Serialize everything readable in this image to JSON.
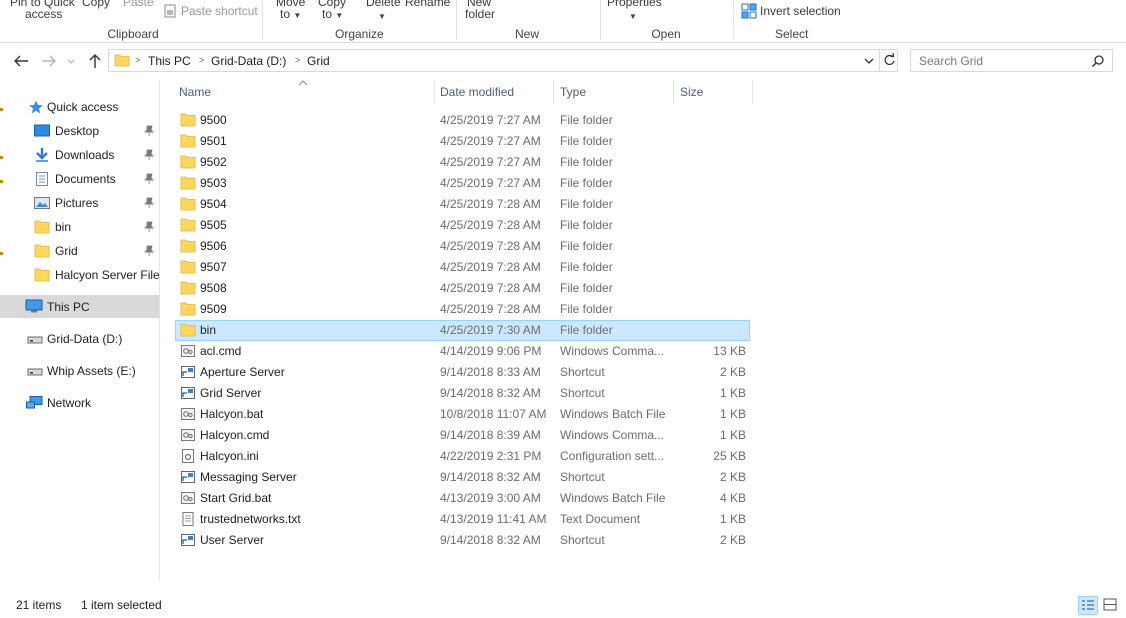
{
  "ribbon": {
    "pin_quick_access": "Pin to Quick",
    "pin_quick_access_2": "access",
    "copy": "Copy",
    "paste": "Paste",
    "paste_shortcut": "Paste shortcut",
    "move_to": "Move",
    "move_to_2": "to",
    "copy_to": "Copy",
    "copy_to_2": "to",
    "delete": "Delete",
    "rename": "Rename",
    "new_folder": "New",
    "new_folder_2": "folder",
    "properties": "Properties",
    "invert_selection": "Invert selection",
    "groups": {
      "clipboard": "Clipboard",
      "organize": "Organize",
      "new": "New",
      "open": "Open",
      "select": "Select"
    }
  },
  "address": {
    "crumbs": [
      "This PC",
      "Grid-Data (D:)",
      "Grid"
    ]
  },
  "search": {
    "placeholder": "Search Grid"
  },
  "sidebar": {
    "items": [
      {
        "label": "Quick access",
        "icon": "star-icon"
      },
      {
        "label": "Desktop",
        "icon": "desktop-icon"
      },
      {
        "label": "Downloads",
        "icon": "download-icon"
      },
      {
        "label": "Documents",
        "icon": "document-icon"
      },
      {
        "label": "Pictures",
        "icon": "pictures-icon"
      },
      {
        "label": "bin",
        "icon": "folder-icon"
      },
      {
        "label": "Grid",
        "icon": "folder-icon"
      },
      {
        "label": "Halcyon Server Files",
        "icon": "folder-icon"
      },
      {
        "label": "This PC",
        "icon": "computer-icon"
      },
      {
        "label": "Grid-Data (D:)",
        "icon": "drive-icon"
      },
      {
        "label": "Whip Assets (E:)",
        "icon": "drive-icon"
      },
      {
        "label": "Network",
        "icon": "network-icon"
      }
    ]
  },
  "columns": {
    "name": "Name",
    "date": "Date modified",
    "type": "Type",
    "size": "Size"
  },
  "files": [
    {
      "name": "9500",
      "date": "4/25/2019 7:27 AM",
      "type": "File folder",
      "size": "",
      "icon": "folder"
    },
    {
      "name": "9501",
      "date": "4/25/2019 7:27 AM",
      "type": "File folder",
      "size": "",
      "icon": "folder"
    },
    {
      "name": "9502",
      "date": "4/25/2019 7:27 AM",
      "type": "File folder",
      "size": "",
      "icon": "folder"
    },
    {
      "name": "9503",
      "date": "4/25/2019 7:27 AM",
      "type": "File folder",
      "size": "",
      "icon": "folder"
    },
    {
      "name": "9504",
      "date": "4/25/2019 7:28 AM",
      "type": "File folder",
      "size": "",
      "icon": "folder"
    },
    {
      "name": "9505",
      "date": "4/25/2019 7:28 AM",
      "type": "File folder",
      "size": "",
      "icon": "folder"
    },
    {
      "name": "9506",
      "date": "4/25/2019 7:28 AM",
      "type": "File folder",
      "size": "",
      "icon": "folder"
    },
    {
      "name": "9507",
      "date": "4/25/2019 7:28 AM",
      "type": "File folder",
      "size": "",
      "icon": "folder"
    },
    {
      "name": "9508",
      "date": "4/25/2019 7:28 AM",
      "type": "File folder",
      "size": "",
      "icon": "folder"
    },
    {
      "name": "9509",
      "date": "4/25/2019 7:28 AM",
      "type": "File folder",
      "size": "",
      "icon": "folder"
    },
    {
      "name": "bin",
      "date": "4/25/2019 7:30 AM",
      "type": "File folder",
      "size": "",
      "icon": "folder"
    },
    {
      "name": "acl.cmd",
      "date": "4/14/2019 9:06 PM",
      "type": "Windows Comma...",
      "size": "13 KB",
      "icon": "script"
    },
    {
      "name": "Aperture Server",
      "date": "9/14/2018 8:33 AM",
      "type": "Shortcut",
      "size": "2 KB",
      "icon": "shortcut"
    },
    {
      "name": "Grid Server",
      "date": "9/14/2018 8:32 AM",
      "type": "Shortcut",
      "size": "1 KB",
      "icon": "shortcut"
    },
    {
      "name": "Halcyon.bat",
      "date": "10/8/2018 11:07 AM",
      "type": "Windows Batch File",
      "size": "1 KB",
      "icon": "script"
    },
    {
      "name": "Halcyon.cmd",
      "date": "9/14/2018 8:39 AM",
      "type": "Windows Comma...",
      "size": "1 KB",
      "icon": "script"
    },
    {
      "name": "Halcyon.ini",
      "date": "4/22/2019 2:31 PM",
      "type": "Configuration sett...",
      "size": "25 KB",
      "icon": "config"
    },
    {
      "name": "Messaging Server",
      "date": "9/14/2018 8:32 AM",
      "type": "Shortcut",
      "size": "2 KB",
      "icon": "shortcut"
    },
    {
      "name": "Start Grid.bat",
      "date": "4/13/2019 3:00 AM",
      "type": "Windows Batch File",
      "size": "4 KB",
      "icon": "script"
    },
    {
      "name": "trustednetworks.txt",
      "date": "4/13/2019 11:41 AM",
      "type": "Text Document",
      "size": "1 KB",
      "icon": "text"
    },
    {
      "name": "User Server",
      "date": "9/14/2018 8:32 AM",
      "type": "Shortcut",
      "size": "2 KB",
      "icon": "shortcut"
    }
  ],
  "selected_file": "bin",
  "status": {
    "items": "21 items",
    "selected": "1 item selected"
  },
  "colors": {
    "selection_bg": "#cce8ff",
    "selection_border": "#99d1ff",
    "folder": "#ffd75e",
    "sidebar_selected": "#d9d9d9"
  }
}
